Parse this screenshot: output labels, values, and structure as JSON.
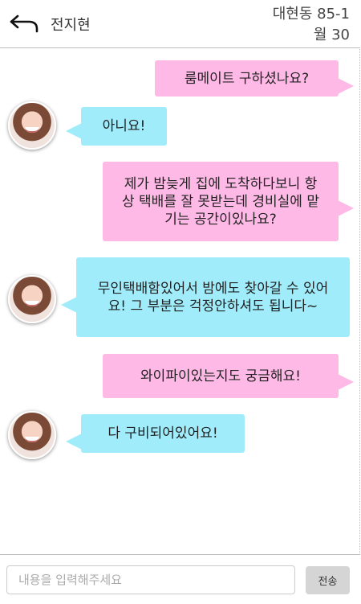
{
  "header": {
    "title": "전지현",
    "room_line1": "대현동 85-1",
    "room_line2": "월 30"
  },
  "messages": [
    {
      "from": "me",
      "text": "룸메이트 구하셨나요?"
    },
    {
      "from": "other",
      "text": "아니요!"
    },
    {
      "from": "me",
      "text": "제가 밤늦게 집에 도착하다보니 항상 택배를 잘 못받는데 경비실에 맡기는 공간이있나요?"
    },
    {
      "from": "other",
      "text": "무인택배함있어서 밤에도 찾아갈 수 있어요! 그 부분은 걱정안하셔도 됩니다~"
    },
    {
      "from": "me",
      "text": "와이파이있는지도 궁금해요!"
    },
    {
      "from": "other",
      "text": "다 구비되어있어요!"
    }
  ],
  "composer": {
    "placeholder": "내용을 입력해주세요",
    "send_label": "전송"
  },
  "colors": {
    "outgoing_bubble": "#ffb9e6",
    "incoming_bubble": "#a0ecfb"
  }
}
